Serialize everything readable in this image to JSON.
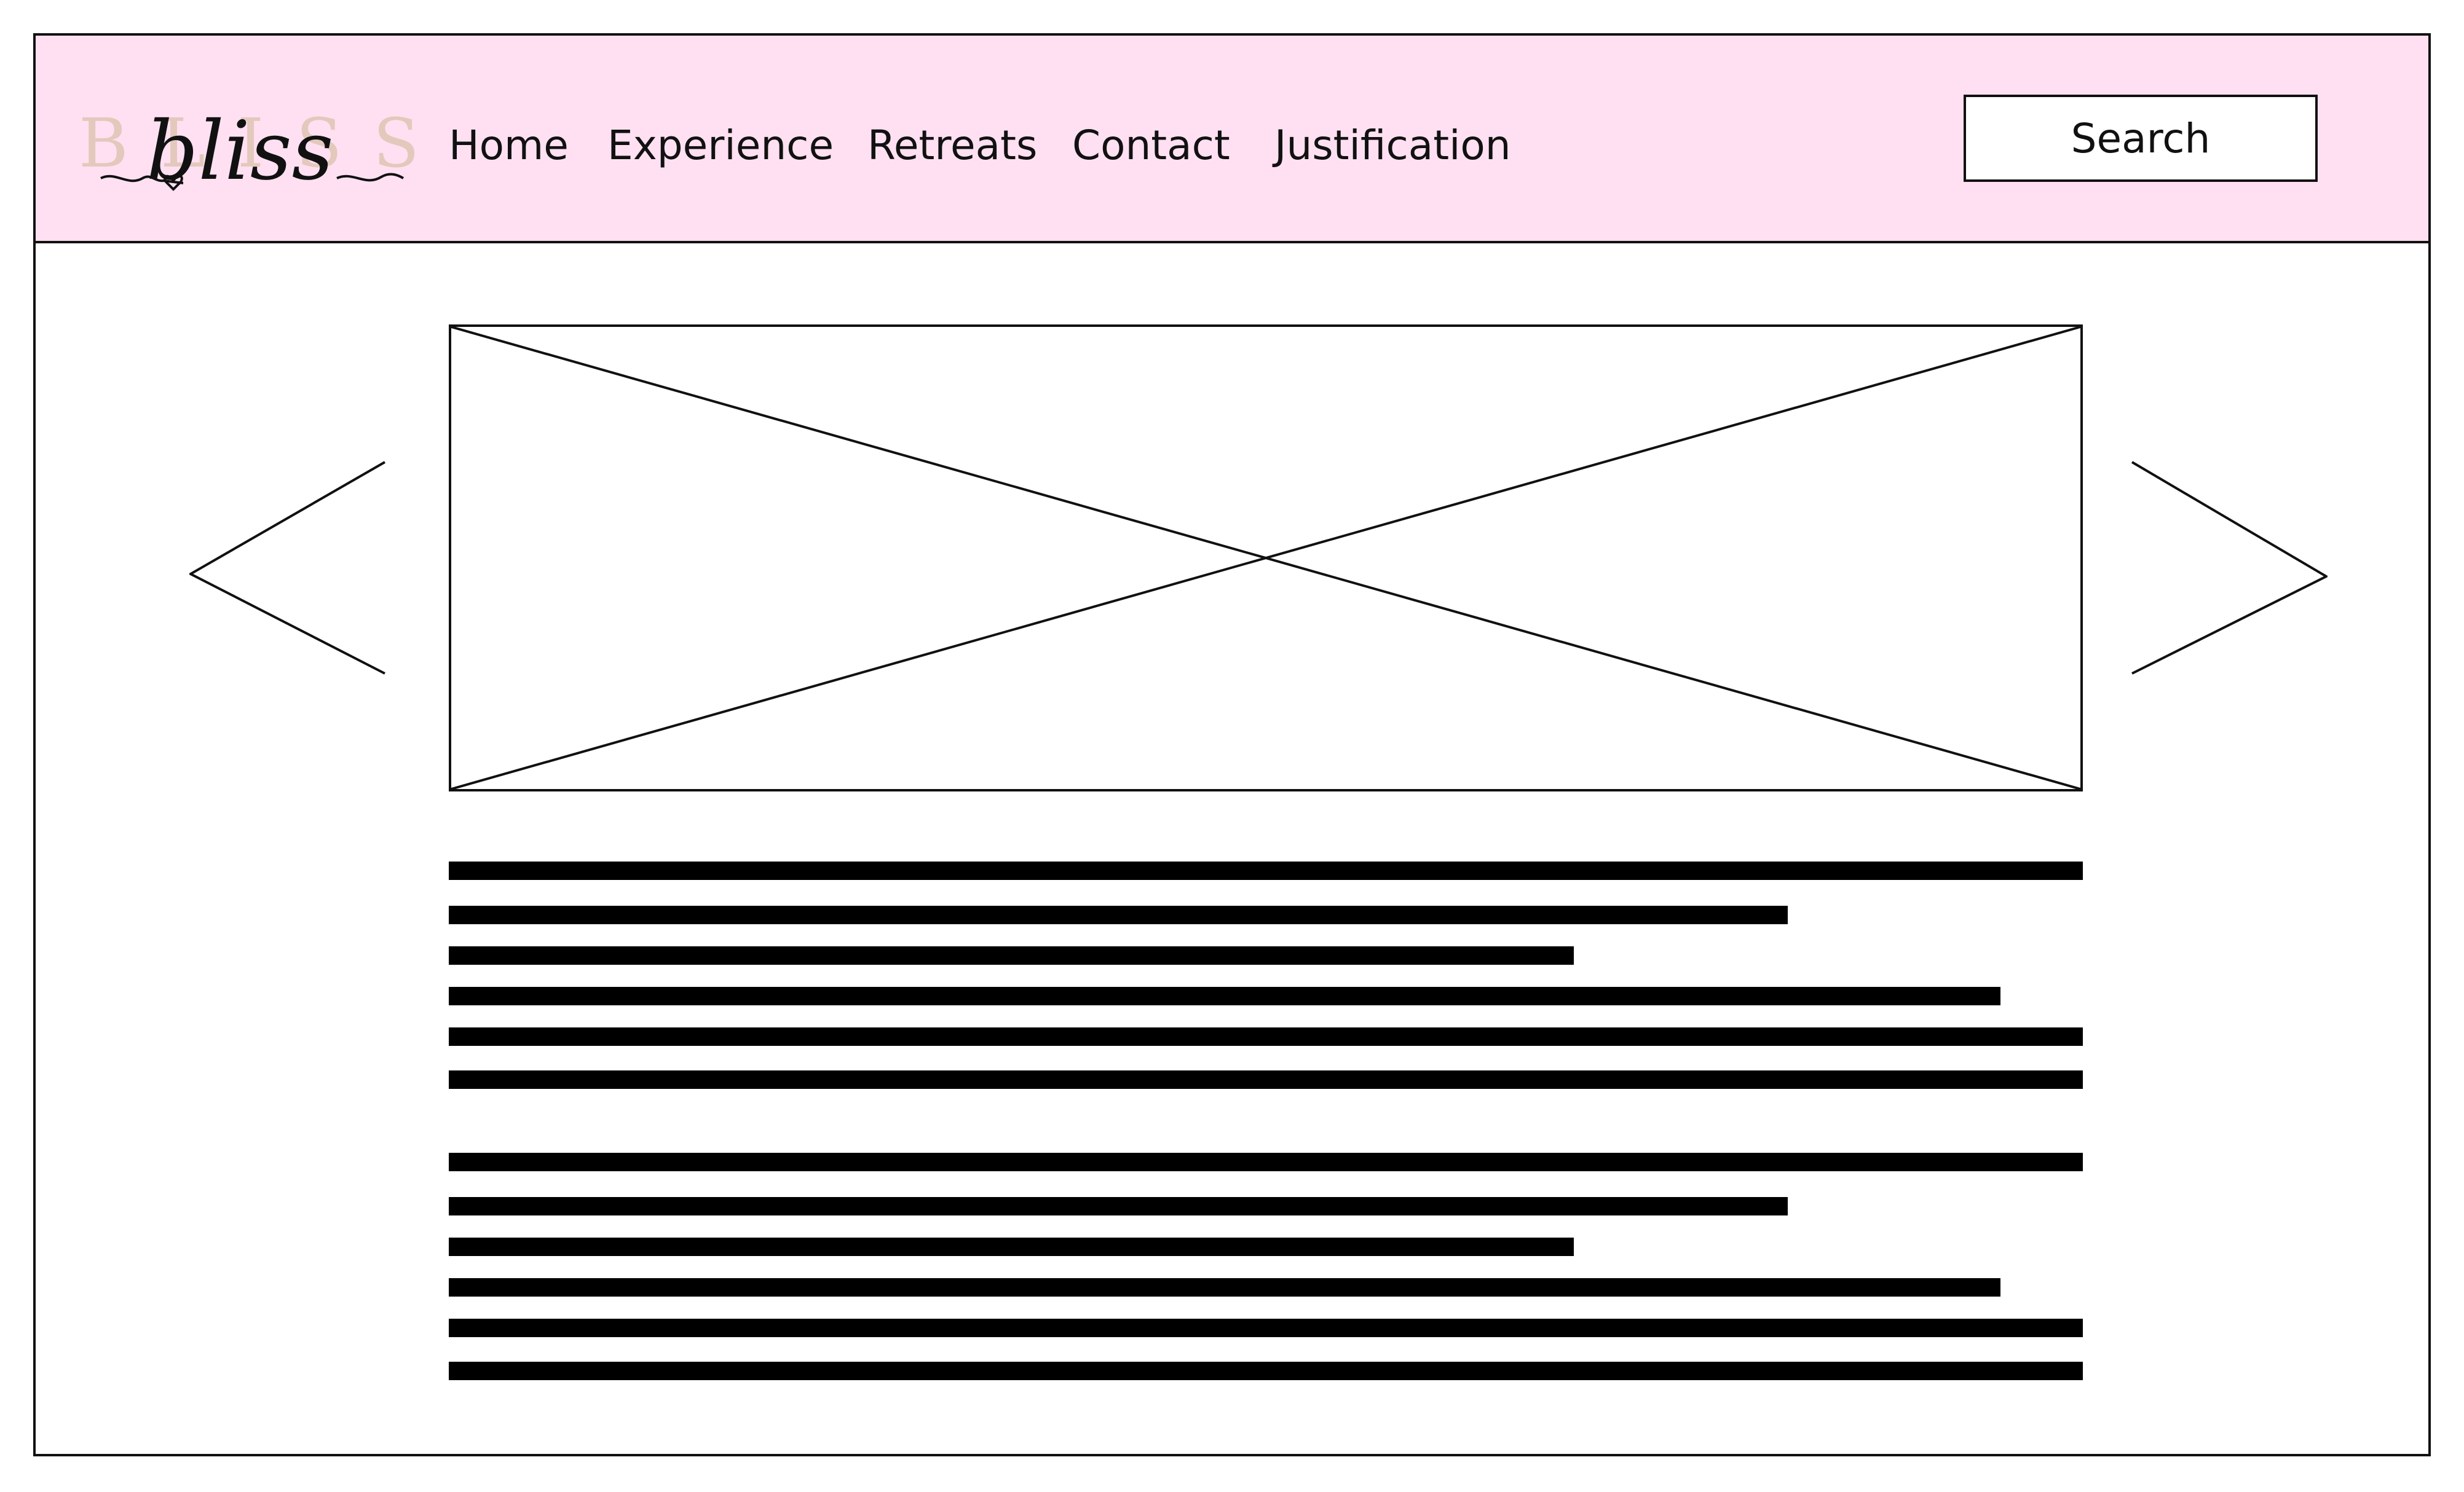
{
  "logo": {
    "wordmark": "BLISS",
    "script": "bliss"
  },
  "nav": {
    "items": [
      {
        "label": "Home"
      },
      {
        "label": "Experience"
      },
      {
        "label": "Retreats"
      },
      {
        "label": "Contact"
      },
      {
        "label": "Justification"
      }
    ]
  },
  "search": {
    "label": "Search"
  },
  "carousel": {
    "prev_icon": "chevron-left-icon",
    "next_icon": "chevron-right-icon",
    "image_icon": "image-placeholder-icon"
  },
  "colors": {
    "header_background": "#ffe0f2",
    "logo_wordmark": "#e3c9bc",
    "ink": "#111111",
    "text_placeholder": "#000000"
  }
}
